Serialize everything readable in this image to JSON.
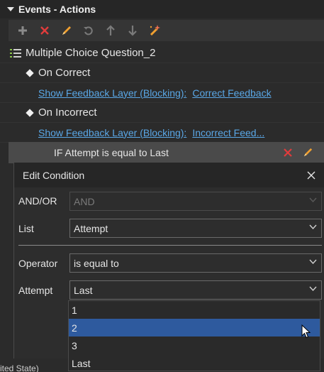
{
  "panel": {
    "title": "Events - Actions"
  },
  "toolbar": {
    "buttons": [
      {
        "icon": "plus-icon",
        "name": "add"
      },
      {
        "icon": "close-icon",
        "name": "delete"
      },
      {
        "icon": "pencil-icon",
        "name": "edit"
      },
      {
        "icon": "undo-icon",
        "name": "undo"
      },
      {
        "icon": "arrow-up-icon",
        "name": "move-up"
      },
      {
        "icon": "arrow-down-icon",
        "name": "move-down"
      },
      {
        "icon": "magic-wand-icon",
        "name": "magic"
      }
    ]
  },
  "tree": {
    "object_label": "Multiple Choice Question_2",
    "on_correct": {
      "label": "On Correct",
      "action_label": "Show Feedback Layer (Blocking):",
      "action_target": "Correct Feedback"
    },
    "on_incorrect": {
      "label": "On Incorrect",
      "action_label": "Show Feedback Layer (Blocking):",
      "action_target": "Incorrect Feed..."
    },
    "condition": {
      "text": "IF Attempt is equal to Last"
    }
  },
  "dialog": {
    "title": "Edit Condition",
    "andor": {
      "label": "AND/OR",
      "value": "AND"
    },
    "list": {
      "label": "List",
      "value": "Attempt"
    },
    "operator": {
      "label": "Operator",
      "value": "is equal to"
    },
    "attempt": {
      "label": "Attempt",
      "value": "Last"
    },
    "options": [
      "1",
      "2",
      "3",
      "Last"
    ],
    "selected_option": "2"
  },
  "footer": {
    "partial_text": "ited State)"
  },
  "colors": {
    "accent": "#2e5a9e",
    "link": "#5aa7e6",
    "delete_red": "#e03c3c",
    "edit_orange": "#f0a030"
  }
}
